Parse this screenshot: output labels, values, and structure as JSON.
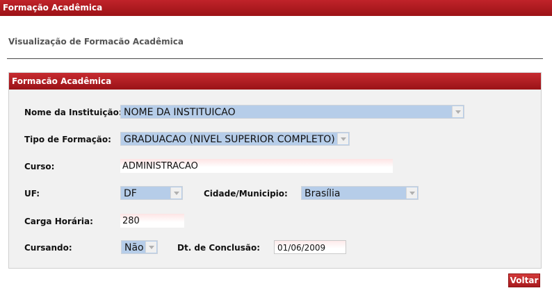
{
  "window": {
    "title": "Formação Acadêmica"
  },
  "page": {
    "subtitle": "Visualização de Formacão Acadêmica"
  },
  "panel": {
    "title": "Formacão Acadêmica"
  },
  "form": {
    "instituicao": {
      "label": "Nome da Instituição:",
      "value": "NOME DA INSTITUICAO"
    },
    "tipo": {
      "label": "Tipo de Formação:",
      "value": "GRADUACAO (NIVEL SUPERIOR COMPLETO)"
    },
    "curso": {
      "label": "Curso:",
      "value": "ADMINISTRACAO"
    },
    "uf": {
      "label": "UF:",
      "value": "DF"
    },
    "cidade": {
      "label": "Cidade/Municipio:",
      "value": "Brasília"
    },
    "carga": {
      "label": "Carga Horária:",
      "value": "280"
    },
    "cursando": {
      "label": "Cursando:",
      "value": "Não"
    },
    "conclusao": {
      "label": "Dt. de Conclusão:",
      "value": "01/06/2009"
    }
  },
  "actions": {
    "back_label": "Voltar"
  },
  "icons": {
    "dropdown_arrow": "chevron-down-icon"
  },
  "colors": {
    "accent": "#b01c21",
    "select_bg": "#b6cde9",
    "panel_bg": "#f1f1f1"
  }
}
